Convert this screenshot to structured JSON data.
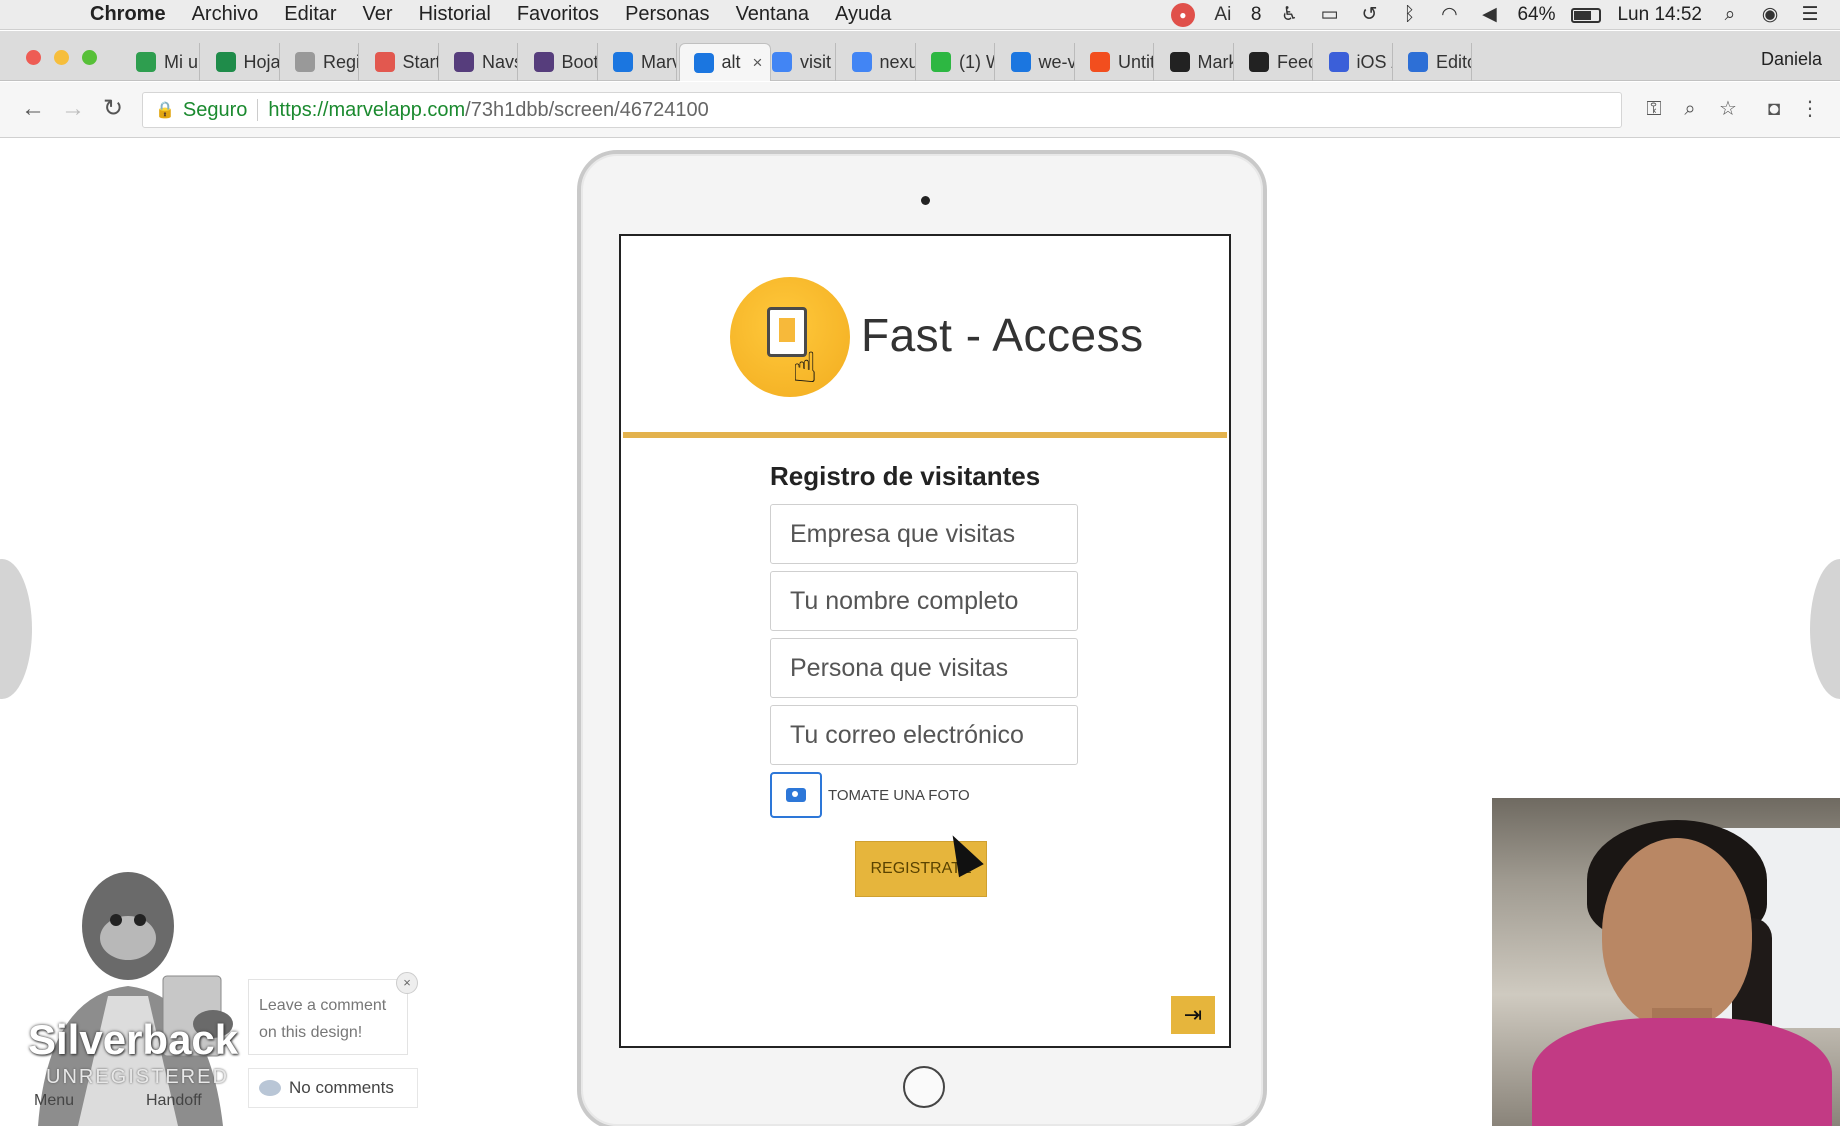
{
  "menubar": {
    "app_name": "Chrome",
    "items": [
      "Archivo",
      "Editar",
      "Ver",
      "Historial",
      "Favoritos",
      "Personas",
      "Ventana",
      "Ayuda"
    ],
    "status": {
      "adobe_count": "8",
      "battery": "64%",
      "clock": "Lun 14:52"
    }
  },
  "tabs": [
    {
      "label": "Mi u",
      "icon": "drive-icon",
      "color": "#2e9e4f"
    },
    {
      "label": "Hoja",
      "icon": "sheets-icon",
      "color": "#1f8c4a"
    },
    {
      "label": "Regi",
      "icon": "doc-icon",
      "color": "#999999"
    },
    {
      "label": "Start",
      "icon": "page-icon",
      "color": "#e2584f"
    },
    {
      "label": "Navs",
      "icon": "bootstrap-icon",
      "color": "#563d7c"
    },
    {
      "label": "Boot",
      "icon": "bootstrap-icon",
      "color": "#563d7c"
    },
    {
      "label": "Marv",
      "icon": "marvel-icon",
      "color": "#1b76e0"
    },
    {
      "label": "alt",
      "icon": "marvel-icon",
      "color": "#1b76e0",
      "active": true
    },
    {
      "label": "visit",
      "icon": "google-icon",
      "color": "#4285f4"
    },
    {
      "label": "nexu",
      "icon": "google-icon",
      "color": "#4285f4"
    },
    {
      "label": "(1) W",
      "icon": "whatsapp-icon",
      "color": "#2db742"
    },
    {
      "label": "we-v",
      "icon": "marvel-icon",
      "color": "#1b76e0"
    },
    {
      "label": "Untit",
      "icon": "figma-icon",
      "color": "#f24e1e"
    },
    {
      "label": "Mark",
      "icon": "github-icon",
      "color": "#222222"
    },
    {
      "label": "Feed",
      "icon": "github-icon",
      "color": "#222222"
    },
    {
      "label": "iOS /",
      "icon": "vp-icon",
      "color": "#3b5fd9"
    },
    {
      "label": "Edito",
      "icon": "editor-icon",
      "color": "#2d6fd6"
    }
  ],
  "profile_name": "Daniela",
  "omnibox": {
    "secure_label": "Seguro",
    "url_host": "https://marvelapp.com",
    "url_path": "/73h1dbb/screen/46724100"
  },
  "app": {
    "brand_name": "Fast - Access",
    "form_title": "Registro de visitantes",
    "fields": [
      {
        "placeholder": "Empresa que visitas"
      },
      {
        "placeholder": "Tu nombre completo"
      },
      {
        "placeholder": "Persona que visitas"
      },
      {
        "placeholder": "Tu correo electrónico"
      }
    ],
    "photo_label": "TOMATE UNA FOTO",
    "submit_label": "REGISTRATE",
    "accent_color": "#e6b53c"
  },
  "silverback": {
    "brand": "Silverback",
    "status": "UNREGISTERED",
    "menu_label": "Menu",
    "handoff_label": "Handoff",
    "comment_prompt": "Leave a comment on this design!",
    "comments_label": "No comments"
  }
}
